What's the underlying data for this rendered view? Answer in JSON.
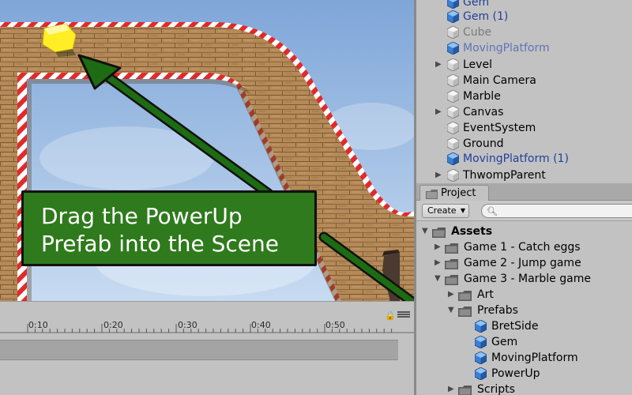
{
  "hierarchy": {
    "items": [
      {
        "label": "Gem",
        "style": "prefab",
        "icon": "prefab-cube-icon",
        "expand": false
      },
      {
        "label": "Gem (1)",
        "style": "prefab",
        "icon": "prefab-cube-icon",
        "expand": false
      },
      {
        "label": "Cube",
        "style": "faded",
        "icon": "gameobject-cube-icon",
        "expand": false
      },
      {
        "label": "MovingPlatform",
        "style": "faded-prefab",
        "icon": "prefab-cube-icon",
        "expand": false
      },
      {
        "label": "Level",
        "style": "normal",
        "icon": "gameobject-cube-icon",
        "expand": true
      },
      {
        "label": "Main Camera",
        "style": "normal",
        "icon": "gameobject-cube-icon",
        "expand": false
      },
      {
        "label": "Marble",
        "style": "normal",
        "icon": "gameobject-cube-icon",
        "expand": false
      },
      {
        "label": "Canvas",
        "style": "normal",
        "icon": "gameobject-cube-icon",
        "expand": true
      },
      {
        "label": "EventSystem",
        "style": "normal",
        "icon": "gameobject-cube-icon",
        "expand": false
      },
      {
        "label": "Ground",
        "style": "normal",
        "icon": "gameobject-cube-icon",
        "expand": false
      },
      {
        "label": "MovingPlatform (1)",
        "style": "prefab",
        "icon": "prefab-cube-icon",
        "expand": false
      },
      {
        "label": "ThwompParent",
        "style": "normal",
        "icon": "gameobject-cube-icon",
        "expand": true
      }
    ]
  },
  "project": {
    "tab_label": "Project",
    "create_label": "Create",
    "search_placeholder": "",
    "tree": [
      {
        "label": "Assets",
        "bold": true,
        "icon": "folder-icon",
        "arrow": "expanded"
      },
      {
        "label": "Game 1 - Catch eggs",
        "bold": false,
        "icon": "folder-icon",
        "arrow": "collapsed"
      },
      {
        "label": "Game 2 - Jump game",
        "bold": false,
        "icon": "folder-icon",
        "arrow": "collapsed"
      },
      {
        "label": "Game 3 - Marble game",
        "bold": false,
        "icon": "folder-icon",
        "arrow": "expanded"
      },
      {
        "label": "Art",
        "bold": false,
        "icon": "folder-icon",
        "arrow": "collapsed"
      },
      {
        "label": "Prefabs",
        "bold": false,
        "icon": "folder-icon",
        "arrow": "expanded"
      },
      {
        "label": "BretSide",
        "bold": false,
        "icon": "prefab-cube-icon",
        "arrow": "none"
      },
      {
        "label": "Gem",
        "bold": false,
        "icon": "prefab-cube-icon",
        "arrow": "none"
      },
      {
        "label": "MovingPlatform",
        "bold": false,
        "icon": "prefab-cube-icon",
        "arrow": "none"
      },
      {
        "label": "PowerUp",
        "bold": false,
        "icon": "prefab-cube-icon",
        "arrow": "none"
      },
      {
        "label": "Scripts",
        "bold": false,
        "icon": "folder-icon",
        "arrow": "collapsed"
      }
    ]
  },
  "timeline": {
    "ticks": [
      "0:10",
      "0:20",
      "0:30",
      "0:40",
      "0:50"
    ]
  },
  "annotation": {
    "line1": "Drag the PowerUp",
    "line2": "Prefab into the Scene",
    "bg_color": "#2e7a1c",
    "arrow_color": "#1d6b12"
  },
  "colors": {
    "prefab_text": "#24409b",
    "panel_bg": "#c2c2c2",
    "sky": "#a9c6e8",
    "wood": "#b08656"
  }
}
